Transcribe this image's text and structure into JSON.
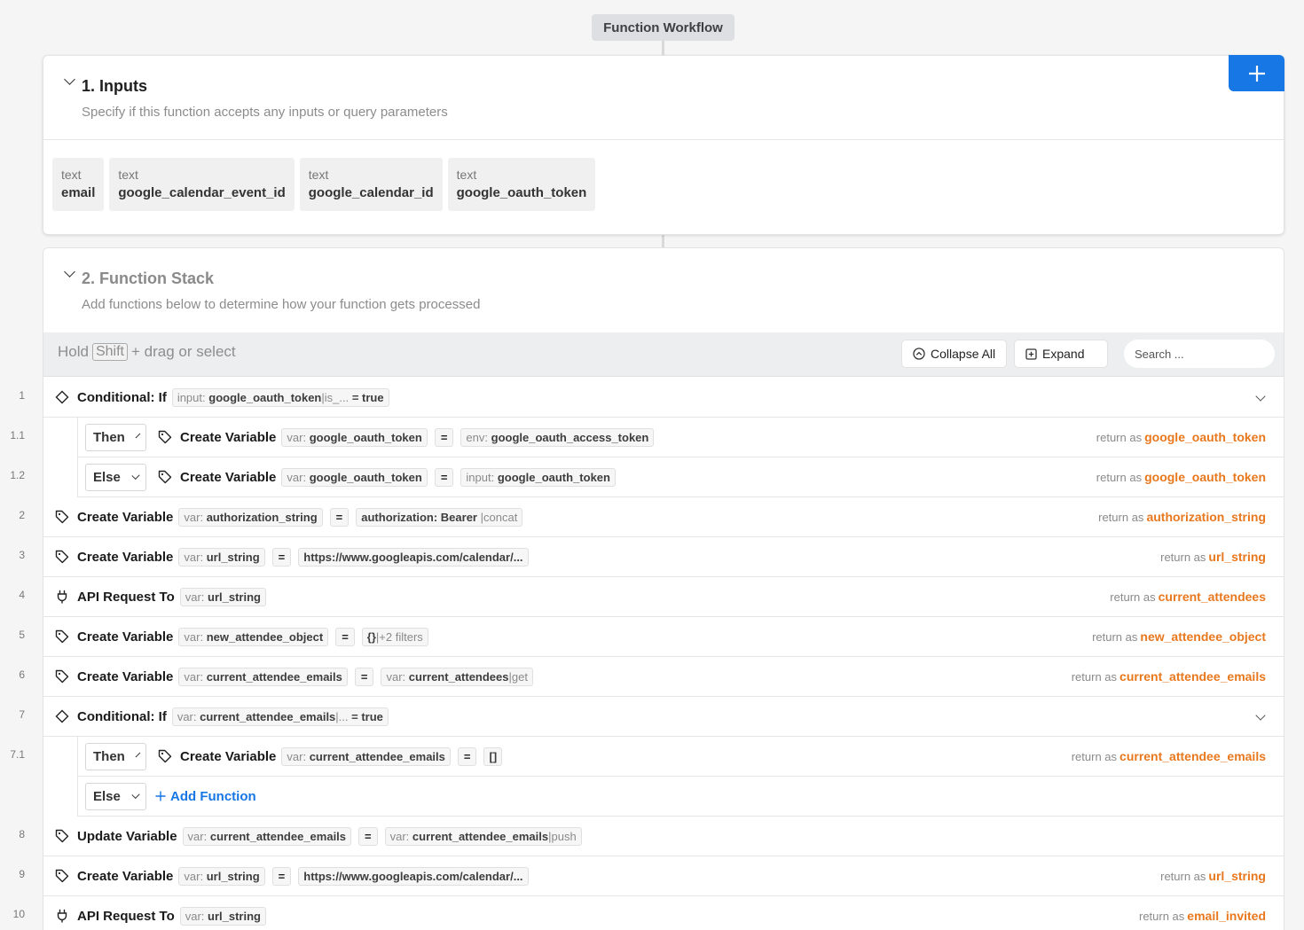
{
  "workflow_title": "Function Workflow",
  "inputs": {
    "title": "1. Inputs",
    "subtitle": "Specify if this function accepts any inputs or query parameters",
    "add_icon": "plus-icon",
    "items": [
      {
        "type": "text",
        "name": "email"
      },
      {
        "type": "text",
        "name": "google_calendar_event_id"
      },
      {
        "type": "text",
        "name": "google_calendar_id"
      },
      {
        "type": "text",
        "name": "google_oauth_token"
      }
    ]
  },
  "stack": {
    "title": "2. Function Stack",
    "subtitle": "Add functions below to determine how your function gets processed",
    "toolbar": {
      "hold": "Hold",
      "key": "Shift",
      "hint": "+ drag or select",
      "collapse_all": "Collapse All",
      "expand": "Expand",
      "search_placeholder": "Search ..."
    },
    "rows": [
      {
        "line": "1",
        "icon": "diamond-icon",
        "name": "Conditional: If",
        "cond_prefix": "input:",
        "cond_var": "google_oauth_token",
        "cond_tail": "|is_...",
        "cond_value": "= true"
      },
      {
        "line": "1.1",
        "branch": "Then",
        "icon": "tag-icon",
        "name": "Create Variable",
        "var": "google_oauth_token",
        "eq": "=",
        "val_prefix": "env:",
        "val": "google_oauth_access_token",
        "return_label": "return as",
        "return_var": "google_oauth_token"
      },
      {
        "line": "1.2",
        "branch": "Else",
        "icon": "tag-icon",
        "name": "Create Variable",
        "var": "google_oauth_token",
        "eq": "=",
        "val_prefix": "input:",
        "val": "google_oauth_token",
        "return_label": "return as",
        "return_var": "google_oauth_token"
      },
      {
        "line": "2",
        "icon": "tag-icon",
        "name": "Create Variable",
        "var": "authorization_string",
        "eq": "=",
        "val": "authorization: Bearer",
        "val_suffix": "|concat",
        "return_label": "return as",
        "return_var": "authorization_string"
      },
      {
        "line": "3",
        "icon": "tag-icon",
        "name": "Create Variable",
        "var": "url_string",
        "eq": "=",
        "val": "https://www.googleapis.com/calendar/...",
        "return_label": "return as",
        "return_var": "url_string"
      },
      {
        "line": "4",
        "icon": "plug-icon",
        "name": "API Request To",
        "var": "url_string",
        "return_label": "return as",
        "return_var": "current_attendees"
      },
      {
        "line": "5",
        "icon": "tag-icon",
        "name": "Create Variable",
        "var": "new_attendee_object",
        "eq": "=",
        "val": "{}",
        "val_suffix": "|+2 filters",
        "return_label": "return as",
        "return_var": "new_attendee_object"
      },
      {
        "line": "6",
        "icon": "tag-icon",
        "name": "Create Variable",
        "var": "current_attendee_emails",
        "eq": "=",
        "val_prefix": "var:",
        "val": "current_attendees",
        "val_suffix": "|get",
        "return_label": "return as",
        "return_var": "current_attendee_emails"
      },
      {
        "line": "7",
        "icon": "diamond-icon",
        "name": "Conditional: If",
        "cond_prefix": "var:",
        "cond_var": "current_attendee_emails",
        "cond_tail": "|...",
        "cond_value": "= true"
      },
      {
        "line": "7.1",
        "branch": "Then",
        "icon": "tag-icon",
        "name": "Create Variable",
        "var": "current_attendee_emails",
        "eq": "=",
        "val": "[]",
        "return_label": "return as",
        "return_var": "current_attendee_emails"
      },
      {
        "branch": "Else",
        "add_function": "Add Function"
      },
      {
        "line": "8",
        "icon": "tag-icon",
        "name": "Update Variable",
        "var": "current_attendee_emails",
        "eq": "=",
        "val_prefix": "var:",
        "val": "current_attendee_emails",
        "val_suffix": "|push"
      },
      {
        "line": "9",
        "icon": "tag-icon",
        "name": "Create Variable",
        "var": "url_string",
        "eq": "=",
        "val": "https://www.googleapis.com/calendar/...",
        "return_label": "return as",
        "return_var": "url_string"
      },
      {
        "line": "10",
        "icon": "plug-icon",
        "name": "API Request To",
        "var": "url_string",
        "return_label": "return as",
        "return_var": "email_invited"
      }
    ]
  },
  "colors": {
    "accent": "#1677e5",
    "return_var": "#e8781e"
  }
}
